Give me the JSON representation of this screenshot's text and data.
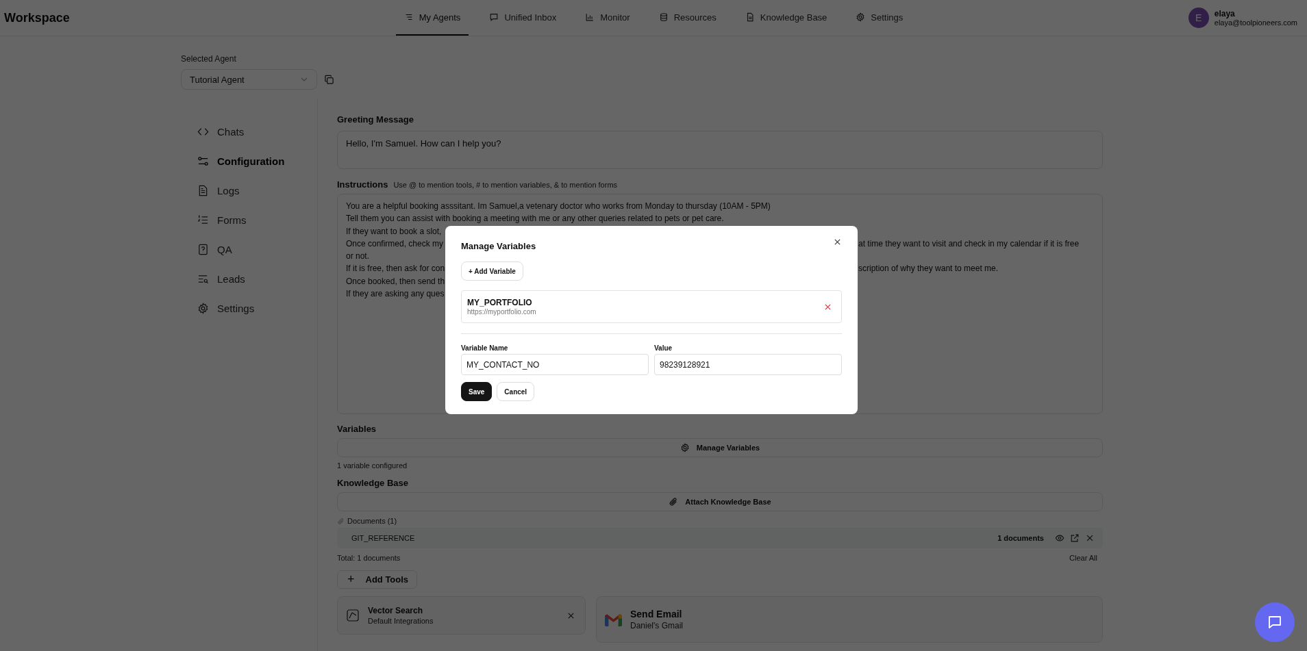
{
  "header": {
    "logo": "Workspace",
    "tabs": [
      {
        "label": "My Agents",
        "selected": true
      },
      {
        "label": "Unified Inbox",
        "selected": false
      },
      {
        "label": "Monitor",
        "selected": false
      },
      {
        "label": "Resources",
        "selected": false
      },
      {
        "label": "Knowledge Base",
        "selected": false
      },
      {
        "label": "Settings",
        "selected": false
      }
    ],
    "user": {
      "initial": "E",
      "name": "elaya",
      "email": "elaya@toolpioneers.com"
    }
  },
  "agent_selector": {
    "label": "Selected Agent",
    "value": "Tutorial Agent"
  },
  "sidebar": {
    "items": [
      {
        "label": "Chats",
        "selected": false
      },
      {
        "label": "Configuration",
        "selected": true
      },
      {
        "label": "Logs",
        "selected": false
      },
      {
        "label": "Forms",
        "selected": false
      },
      {
        "label": "QA",
        "selected": false
      },
      {
        "label": "Leads",
        "selected": false
      },
      {
        "label": "Settings",
        "selected": false
      }
    ]
  },
  "greeting": {
    "label": "Greeting Message",
    "value": "Hello, I'm Samuel. How can I help you?"
  },
  "instructions": {
    "label": "Instructions",
    "hint": "Use @ to mention tools, # to mention variables, & to mention forms",
    "lines": [
      {
        "left": "You are a helpful booking asssitant. Im Samuel,a vetenary doctor who works from Monday to thursday (10AM - 5PM)"
      },
      {
        "left": "Tell them you can assist with booking a meeting with me or any other queries related to pets or pet care."
      },
      {
        "left": "If they want to book a slot,"
      },
      {
        "left": "Once confirmed, check my",
        "right": "at time they want to visit and check in my calendar if it is free"
      },
      {
        "left": "or not."
      },
      {
        "left": "If it is free, then ask for con",
        "right": "scription of why they want to meet me."
      },
      {
        "left": "Once booked, then send th"
      },
      {
        "left": "If they are asking any ques"
      }
    ]
  },
  "variables": {
    "label": "Variables",
    "button": "Manage Variables",
    "note": "1 variable configured"
  },
  "knowledge_base": {
    "label": "Knowledge Base",
    "button": "Attach Knowledge Base",
    "documents_label": "Documents (1)",
    "documents": [
      {
        "name": "GIT_REFERENCE",
        "count": "1 documents"
      }
    ],
    "total": "Total: 1 documents",
    "clear": "Clear All"
  },
  "tools": {
    "add_icon": "+",
    "add_button": "Add Tools",
    "items": [
      {
        "kind": "vector",
        "name": "Vector Search",
        "subtitle": "Default Integrations",
        "removable": true
      },
      {
        "kind": "gmail",
        "name": "Send Email",
        "subtitle": "Daniel's Gmail",
        "removable": false
      }
    ]
  },
  "modal": {
    "title": "Manage Variables",
    "add_button": "+ Add Variable",
    "variables": [
      {
        "name": "MY_PORTFOLIO",
        "value": "https://myportfolio.com"
      }
    ],
    "form": {
      "name_label": "Variable Name",
      "name_value": "MY_CONTACT_NO",
      "value_label": "Value",
      "value_value": "98239128921"
    },
    "save": "Save",
    "cancel": "Cancel"
  }
}
